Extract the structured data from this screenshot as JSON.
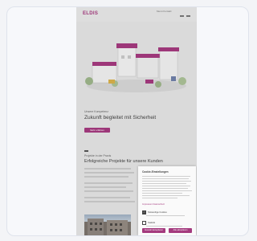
{
  "page": {
    "logo": "ELDIS",
    "header_links": "Menü  Kontakt",
    "section1": {
      "eyebrow": "Unsere Kompetenz",
      "title": "Zukunft begleitet mit Sicherheit",
      "button_label": "Mehr erfahren"
    },
    "section2": {
      "eyebrow": "Projekte in der Praxis",
      "title": "Erfolgreiche Projekte für unsere Kunden"
    }
  },
  "cookie": {
    "title": "Cookie-Einstellungen",
    "links": "Impressum  Datenschutz",
    "options": [
      {
        "label": "Notwendige Cookies",
        "checked": true
      },
      {
        "label": "Statistik",
        "checked": false
      }
    ],
    "accept_selected_label": "Auswahl akzeptieren",
    "accept_all_label": "Alle akzeptieren"
  },
  "colors": {
    "accent": "#a43a7e",
    "background": "#e3e3e3"
  }
}
